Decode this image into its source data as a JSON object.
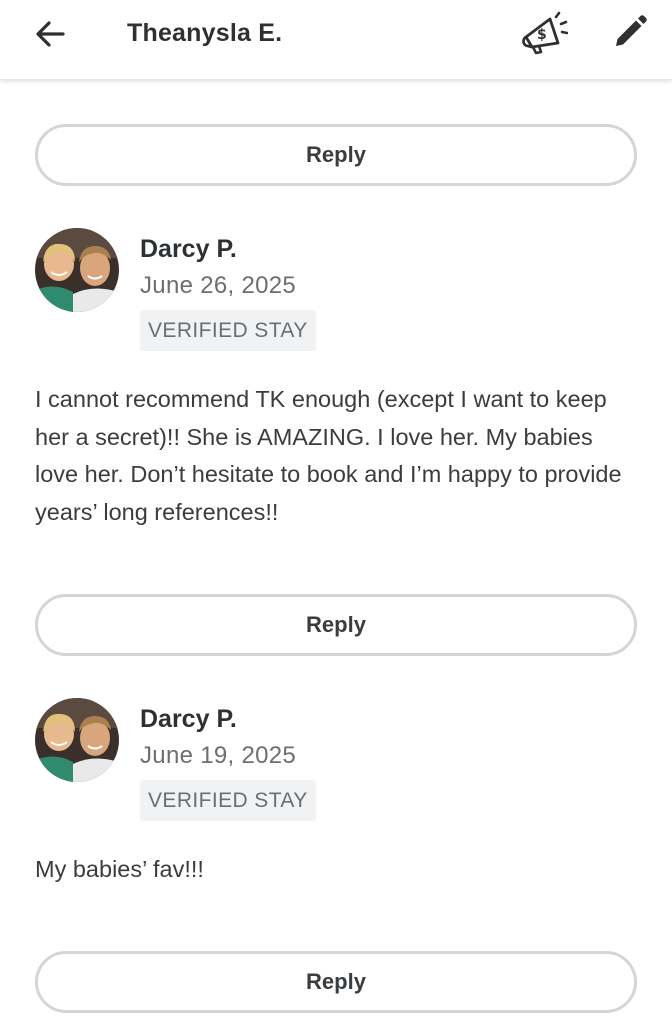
{
  "header": {
    "title": "Theanysla E.",
    "back_icon": "arrow-left-icon",
    "promo_icon": "megaphone-dollar-icon",
    "edit_icon": "pencil-icon"
  },
  "reply_label": "Reply",
  "reviews": [
    {
      "name": "Darcy P.",
      "date": "June 26, 2025",
      "badge": "VERIFIED STAY",
      "text": "I cannot recommend TK enough (except I want to keep her a secret)!! She is AMAZING. I love her. My babies love her. Don’t hesitate to book and I’m happy to provide years’ long references!!"
    },
    {
      "name": "Darcy P.",
      "date": "June 19, 2025",
      "badge": "VERIFIED STAY",
      "text": "My babies’ fav!!!"
    }
  ],
  "colors": {
    "text_primary": "#2e3133",
    "text_secondary": "#6b6f72",
    "border": "#d3d5d7",
    "badge_bg": "#f1f2f3"
  }
}
